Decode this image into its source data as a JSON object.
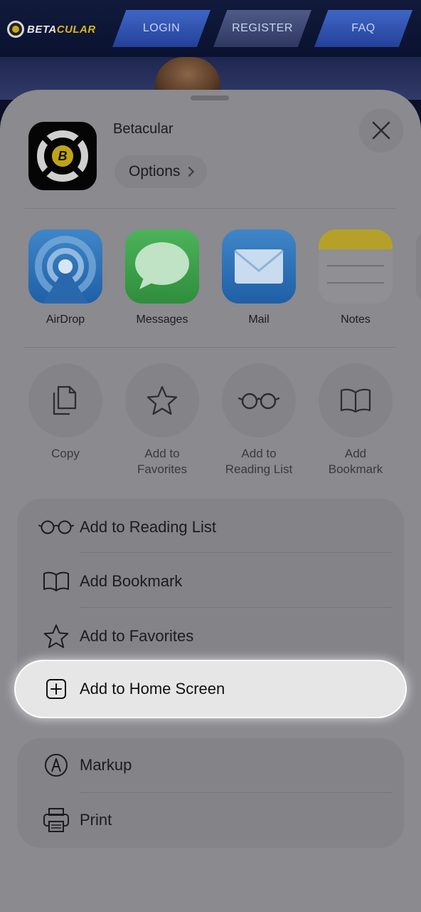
{
  "site": {
    "logo_prefix": "BETA",
    "logo_suffix": "CULAR",
    "nav": [
      {
        "label": "LOGIN"
      },
      {
        "label": "REGISTER"
      },
      {
        "label": "FAQ"
      }
    ]
  },
  "sheet": {
    "app_name": "Betacular",
    "app_icon_letter": "B",
    "options_label": "Options",
    "apps": [
      {
        "label": "AirDrop",
        "icon": "airdrop-icon"
      },
      {
        "label": "Messages",
        "icon": "messages-icon"
      },
      {
        "label": "Mail",
        "icon": "mail-icon"
      },
      {
        "label": "Notes",
        "icon": "notes-icon"
      }
    ],
    "actions": [
      {
        "label": "Copy",
        "icon": "copy-icon"
      },
      {
        "label": "Add to\nFavorites",
        "icon": "star-icon"
      },
      {
        "label": "Add to\nReading List",
        "icon": "glasses-icon"
      },
      {
        "label": "Add\nBookmark",
        "icon": "book-icon"
      }
    ],
    "list_group_1": [
      {
        "label": "Add to Reading List",
        "icon": "glasses-icon"
      },
      {
        "label": "Add Bookmark",
        "icon": "book-icon"
      },
      {
        "label": "Add to Favorites",
        "icon": "star-icon"
      },
      {
        "label": "Add to Home Screen",
        "icon": "plus-square-icon"
      }
    ],
    "list_group_2": [
      {
        "label": "Markup",
        "icon": "markup-icon"
      },
      {
        "label": "Print",
        "icon": "printer-icon"
      }
    ]
  },
  "colors": {
    "sheet_bg": "#8a8a8f",
    "highlight_bg": "#e6e6e6",
    "logo_accent": "#d6b61a"
  }
}
